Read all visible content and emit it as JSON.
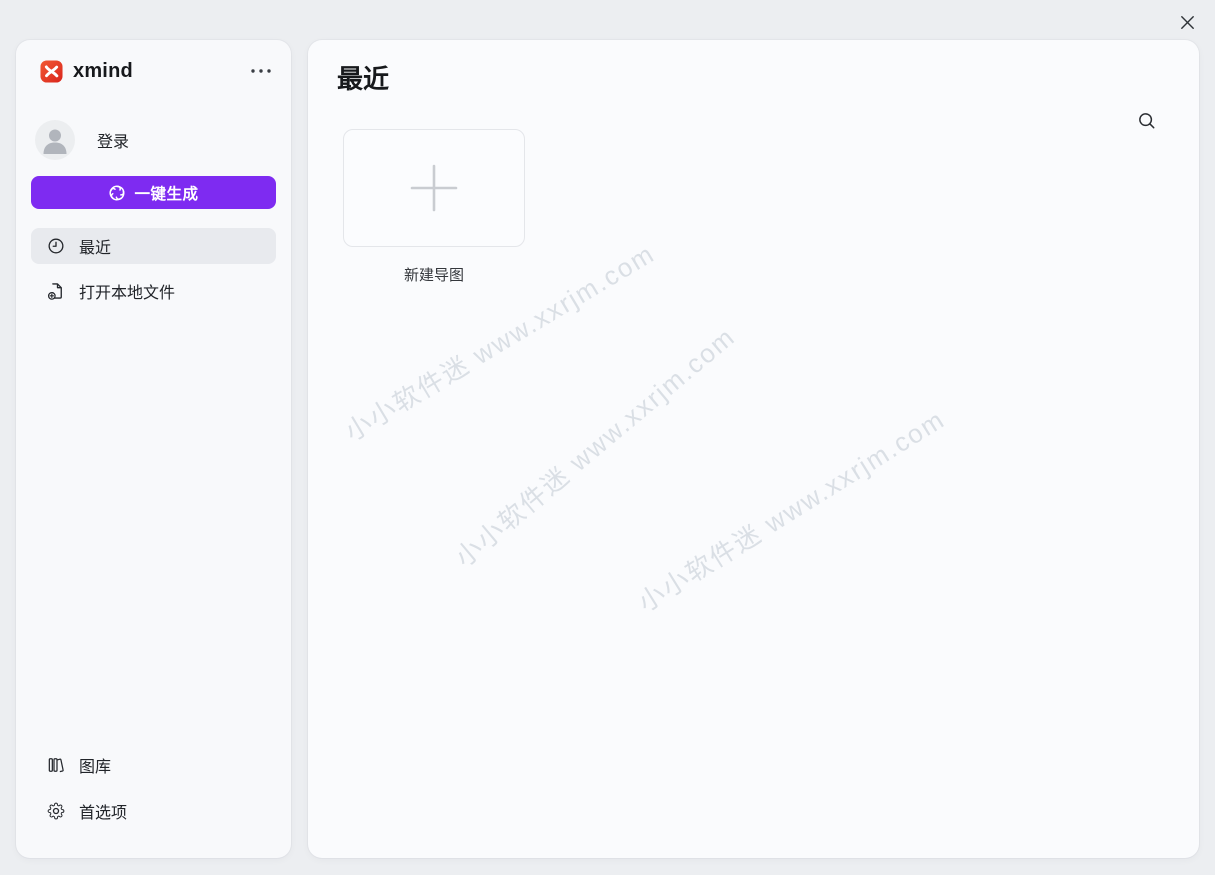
{
  "titlebar": {
    "close_icon": "close-x"
  },
  "sidebar": {
    "logo_text": "xmind",
    "logo_icon": "xmind-red-mark",
    "overflow_icon": "three-dots-menu",
    "account": {
      "avatar_icon": "person-silhouette",
      "login_label": "登录"
    },
    "generate_button": {
      "icon": "ai-swirl",
      "label": "一键生成"
    },
    "nav_items": [
      {
        "label": "最近",
        "icon": "clock",
        "selected": true
      },
      {
        "label": "打开本地文件",
        "icon": "file-plus",
        "selected": false
      }
    ],
    "footer_items": [
      {
        "label": "图库",
        "icon": "library-books"
      },
      {
        "label": "首选项",
        "icon": "gear"
      }
    ]
  },
  "main": {
    "heading": "最近",
    "search_icon": "magnifier",
    "new_map_card": {
      "icon": "plus",
      "label": "新建导图"
    }
  },
  "watermark": {
    "text": "小小软件迷 www.xxrjm.com",
    "instances": 3
  },
  "colors": {
    "window_bg": "#eceef1",
    "sidebar_bg": "#f8f9fb",
    "main_bg": "#fafbfd",
    "accent_purple": "#7e2bf1",
    "selected_item_bg": "#e8eaee",
    "logo_red": "#e63a28",
    "text_primary": "#1c1e22",
    "watermark_gray": "rgba(147,159,176,0.30)",
    "card_border": "#e4e6ea",
    "plus_gray": "#c9ccd1"
  }
}
